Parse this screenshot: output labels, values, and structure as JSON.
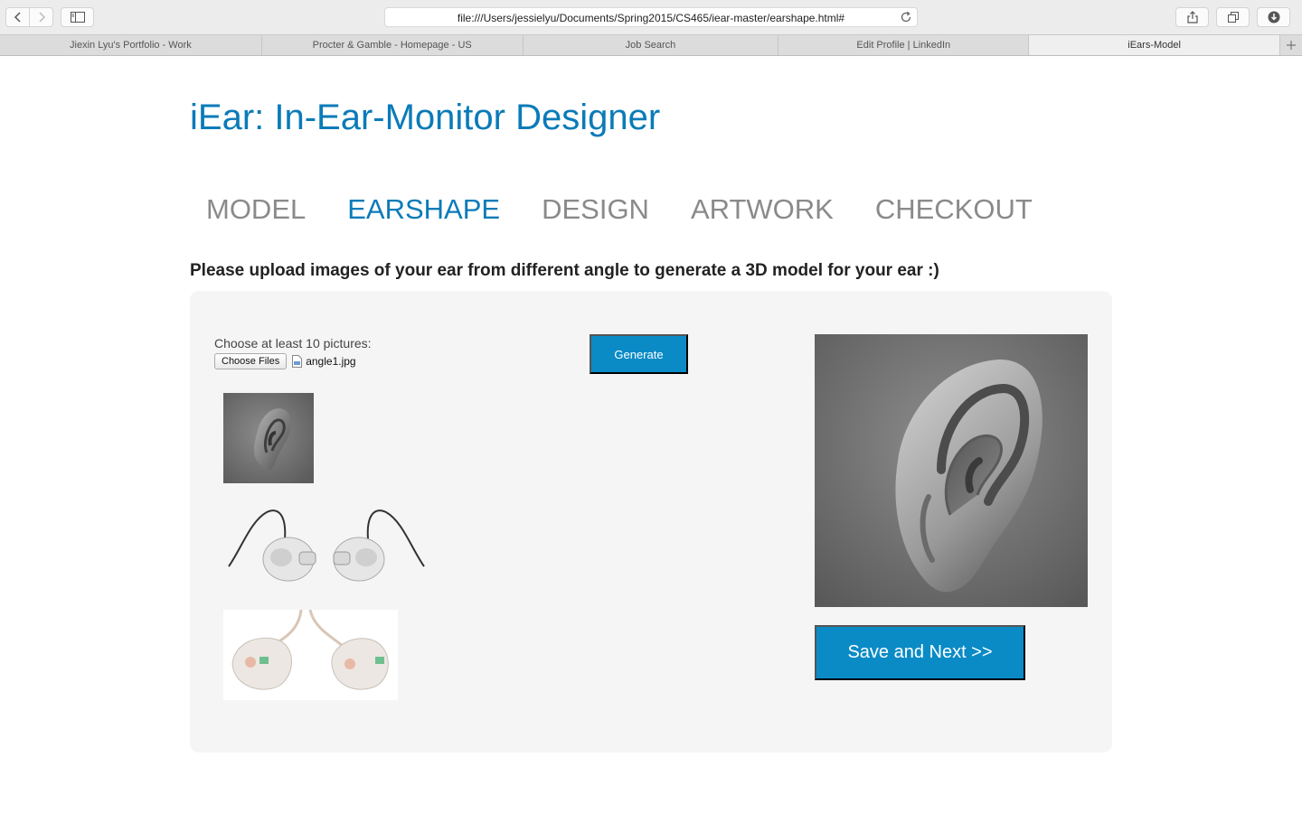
{
  "browser": {
    "url": "file:///Users/jessielyu/Documents/Spring2015/CS465/iear-master/earshape.html#",
    "tabs": [
      {
        "label": "Jiexin Lyu's Portfolio - Work"
      },
      {
        "label": "Procter & Gamble - Homepage - US"
      },
      {
        "label": "Job Search"
      },
      {
        "label": "Edit Profile | LinkedIn"
      },
      {
        "label": "iEars-Model"
      }
    ],
    "active_tab": 4,
    "icons": {
      "back": "chevron-left-icon",
      "forward": "chevron-right-icon",
      "sidebar": "sidebar-icon",
      "reload": "reload-icon",
      "share": "share-icon",
      "tabs": "tabs-overview-icon",
      "downloads": "download-icon",
      "new_tab": "plus-icon"
    }
  },
  "page": {
    "title": "iEar: In-Ear-Monitor Designer",
    "steps": [
      {
        "label": "MODEL"
      },
      {
        "label": "EARSHAPE"
      },
      {
        "label": "DESIGN"
      },
      {
        "label": "ARTWORK"
      },
      {
        "label": "CHECKOUT"
      }
    ],
    "active_step": 1,
    "instructions": "Please upload images of your ear from different angle to generate a 3D model for your ear :)",
    "upload": {
      "label": "Choose at least 10 pictures:",
      "button_label": "Choose Files",
      "file_name": "angle1.jpg"
    },
    "thumbnails": [
      "ear-photo",
      "in-ear-monitors-with-cables",
      "clear-custom-ear-monitors"
    ],
    "generate_label": "Generate",
    "preview": "ear-3d-model",
    "save_label": "Save and Next >>"
  },
  "colors": {
    "accent": "#0a7bb8",
    "button": "#0a8bc6",
    "inactive_step": "#8a8a8a",
    "panel_bg": "#f5f5f5"
  }
}
